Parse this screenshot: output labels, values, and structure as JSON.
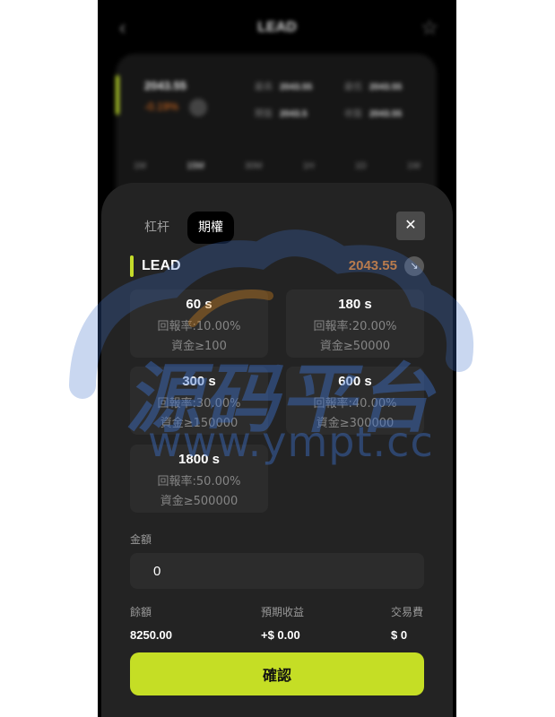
{
  "background": {
    "nav_title": "LEAD",
    "price": "2043.55",
    "change": "-0.19%",
    "stats": [
      {
        "label": "最高",
        "value": "2043.55"
      },
      {
        "label": "最低",
        "value": "2043.55"
      },
      {
        "label": "開盤",
        "value": "2043.5"
      },
      {
        "label": "收盤",
        "value": "2043.55"
      }
    ],
    "tabs": [
      "1M",
      "15M",
      "30M",
      "1H",
      "1D",
      "1W"
    ],
    "active_tab": "15M"
  },
  "sheet": {
    "tabs": [
      {
        "label": "杠杆",
        "active": false
      },
      {
        "label": "期權",
        "active": true
      }
    ],
    "close_icon": "close-icon",
    "asset": {
      "name": "LEAD",
      "price": "2043.55",
      "trend_icon": "arrow-down-right-icon"
    },
    "periods": [
      {
        "time": "60 s",
        "rate": "回報率:10.00%",
        "min": "資金≥100"
      },
      {
        "time": "180 s",
        "rate": "回報率:20.00%",
        "min": "資金≥50000"
      },
      {
        "time": "300 s",
        "rate": "回報率:30.00%",
        "min": "資金≥150000"
      },
      {
        "time": "600 s",
        "rate": "回報率:40.00%",
        "min": "資金≥300000"
      },
      {
        "time": "1800 s",
        "rate": "回報率:50.00%",
        "min": "資金≥500000"
      }
    ],
    "amount_label": "金額",
    "amount_value": "0",
    "summary": {
      "balance_label": "餘額",
      "balance_value": "8250.00",
      "expected_label": "預期收益",
      "expected_value": "+$ 0.00",
      "fee_label": "交易費",
      "fee_value": "$ 0"
    },
    "confirm_label": "確認"
  },
  "watermark": {
    "text": "源码平台",
    "url": "www.ympt.cc"
  },
  "colors": {
    "accent": "#c5de25",
    "price": "#e8801e",
    "sheet_bg": "#232323",
    "card_bg": "#2c2c2c"
  }
}
